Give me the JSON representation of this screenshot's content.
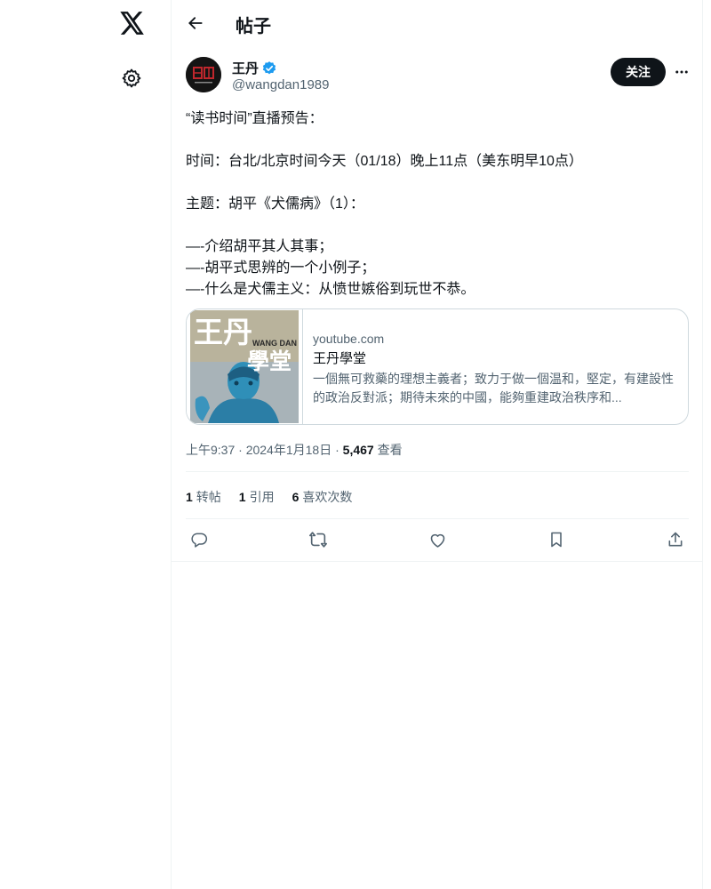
{
  "sidebar": {
    "logo_icon": "x-logo-icon",
    "settings_icon": "gear-icon"
  },
  "header": {
    "title": "帖子"
  },
  "tweet": {
    "author": {
      "name": "王丹",
      "handle": "@wangdan1989",
      "verified": true
    },
    "follow_label": "关注",
    "lines": [
      "“读书时间”直播预告：",
      "",
      "时间：台北/北京时间今天（01/18）晚上11点（美东明早10点）",
      "",
      "主题：胡平《犬儒病》（1）：",
      "",
      "—-介绍胡平其人其事；",
      "—-胡平式思辨的一个小例子；",
      "—-什么是犬儒主义：从愤世嫉俗到玩世不恭。"
    ],
    "card": {
      "thumb_title": "王丹",
      "thumb_subtitle": "學堂",
      "thumb_en": "WANG DAN",
      "domain": "youtube.com",
      "title": "王丹學堂",
      "description": "一個無可救藥的理想主義者；致力于做一個温和，堅定，有建設性的政治反對派；期待未來的中國，能夠重建政治秩序和..."
    },
    "time": "上午9:37",
    "date": "2024年1月18日",
    "views": "5,467",
    "views_label": "查看",
    "stats": {
      "retweets": "1",
      "retweets_label": "转帖",
      "quotes": "1",
      "quotes_label": "引用",
      "likes": "6",
      "likes_label": "喜欢次数"
    }
  },
  "colors": {
    "accent": "#1d9bf0",
    "text": "#0f1419",
    "muted": "#536471",
    "border": "#eff3f4"
  }
}
